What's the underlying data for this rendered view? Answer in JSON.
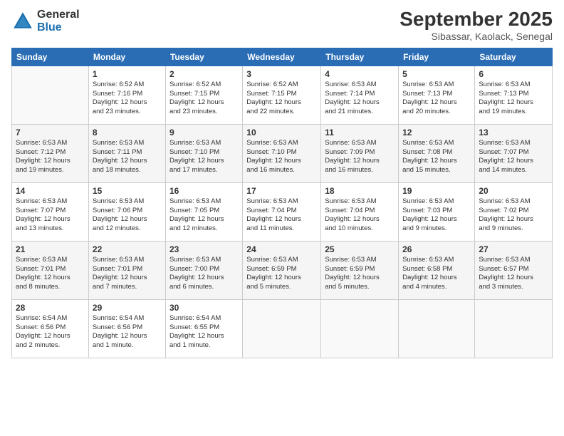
{
  "logo": {
    "general": "General",
    "blue": "Blue"
  },
  "title": "September 2025",
  "subtitle": "Sibassar, Kaolack, Senegal",
  "days_of_week": [
    "Sunday",
    "Monday",
    "Tuesday",
    "Wednesday",
    "Thursday",
    "Friday",
    "Saturday"
  ],
  "weeks": [
    [
      {
        "day": "",
        "detail": ""
      },
      {
        "day": "1",
        "detail": "Sunrise: 6:52 AM\nSunset: 7:16 PM\nDaylight: 12 hours\nand 23 minutes."
      },
      {
        "day": "2",
        "detail": "Sunrise: 6:52 AM\nSunset: 7:15 PM\nDaylight: 12 hours\nand 23 minutes."
      },
      {
        "day": "3",
        "detail": "Sunrise: 6:52 AM\nSunset: 7:15 PM\nDaylight: 12 hours\nand 22 minutes."
      },
      {
        "day": "4",
        "detail": "Sunrise: 6:53 AM\nSunset: 7:14 PM\nDaylight: 12 hours\nand 21 minutes."
      },
      {
        "day": "5",
        "detail": "Sunrise: 6:53 AM\nSunset: 7:13 PM\nDaylight: 12 hours\nand 20 minutes."
      },
      {
        "day": "6",
        "detail": "Sunrise: 6:53 AM\nSunset: 7:13 PM\nDaylight: 12 hours\nand 19 minutes."
      }
    ],
    [
      {
        "day": "7",
        "detail": "Sunrise: 6:53 AM\nSunset: 7:12 PM\nDaylight: 12 hours\nand 19 minutes."
      },
      {
        "day": "8",
        "detail": "Sunrise: 6:53 AM\nSunset: 7:11 PM\nDaylight: 12 hours\nand 18 minutes."
      },
      {
        "day": "9",
        "detail": "Sunrise: 6:53 AM\nSunset: 7:10 PM\nDaylight: 12 hours\nand 17 minutes."
      },
      {
        "day": "10",
        "detail": "Sunrise: 6:53 AM\nSunset: 7:10 PM\nDaylight: 12 hours\nand 16 minutes."
      },
      {
        "day": "11",
        "detail": "Sunrise: 6:53 AM\nSunset: 7:09 PM\nDaylight: 12 hours\nand 16 minutes."
      },
      {
        "day": "12",
        "detail": "Sunrise: 6:53 AM\nSunset: 7:08 PM\nDaylight: 12 hours\nand 15 minutes."
      },
      {
        "day": "13",
        "detail": "Sunrise: 6:53 AM\nSunset: 7:07 PM\nDaylight: 12 hours\nand 14 minutes."
      }
    ],
    [
      {
        "day": "14",
        "detail": "Sunrise: 6:53 AM\nSunset: 7:07 PM\nDaylight: 12 hours\nand 13 minutes."
      },
      {
        "day": "15",
        "detail": "Sunrise: 6:53 AM\nSunset: 7:06 PM\nDaylight: 12 hours\nand 12 minutes."
      },
      {
        "day": "16",
        "detail": "Sunrise: 6:53 AM\nSunset: 7:05 PM\nDaylight: 12 hours\nand 12 minutes."
      },
      {
        "day": "17",
        "detail": "Sunrise: 6:53 AM\nSunset: 7:04 PM\nDaylight: 12 hours\nand 11 minutes."
      },
      {
        "day": "18",
        "detail": "Sunrise: 6:53 AM\nSunset: 7:04 PM\nDaylight: 12 hours\nand 10 minutes."
      },
      {
        "day": "19",
        "detail": "Sunrise: 6:53 AM\nSunset: 7:03 PM\nDaylight: 12 hours\nand 9 minutes."
      },
      {
        "day": "20",
        "detail": "Sunrise: 6:53 AM\nSunset: 7:02 PM\nDaylight: 12 hours\nand 9 minutes."
      }
    ],
    [
      {
        "day": "21",
        "detail": "Sunrise: 6:53 AM\nSunset: 7:01 PM\nDaylight: 12 hours\nand 8 minutes."
      },
      {
        "day": "22",
        "detail": "Sunrise: 6:53 AM\nSunset: 7:01 PM\nDaylight: 12 hours\nand 7 minutes."
      },
      {
        "day": "23",
        "detail": "Sunrise: 6:53 AM\nSunset: 7:00 PM\nDaylight: 12 hours\nand 6 minutes."
      },
      {
        "day": "24",
        "detail": "Sunrise: 6:53 AM\nSunset: 6:59 PM\nDaylight: 12 hours\nand 5 minutes."
      },
      {
        "day": "25",
        "detail": "Sunrise: 6:53 AM\nSunset: 6:59 PM\nDaylight: 12 hours\nand 5 minutes."
      },
      {
        "day": "26",
        "detail": "Sunrise: 6:53 AM\nSunset: 6:58 PM\nDaylight: 12 hours\nand 4 minutes."
      },
      {
        "day": "27",
        "detail": "Sunrise: 6:53 AM\nSunset: 6:57 PM\nDaylight: 12 hours\nand 3 minutes."
      }
    ],
    [
      {
        "day": "28",
        "detail": "Sunrise: 6:54 AM\nSunset: 6:56 PM\nDaylight: 12 hours\nand 2 minutes."
      },
      {
        "day": "29",
        "detail": "Sunrise: 6:54 AM\nSunset: 6:56 PM\nDaylight: 12 hours\nand 1 minute."
      },
      {
        "day": "30",
        "detail": "Sunrise: 6:54 AM\nSunset: 6:55 PM\nDaylight: 12 hours\nand 1 minute."
      },
      {
        "day": "",
        "detail": ""
      },
      {
        "day": "",
        "detail": ""
      },
      {
        "day": "",
        "detail": ""
      },
      {
        "day": "",
        "detail": ""
      }
    ]
  ]
}
